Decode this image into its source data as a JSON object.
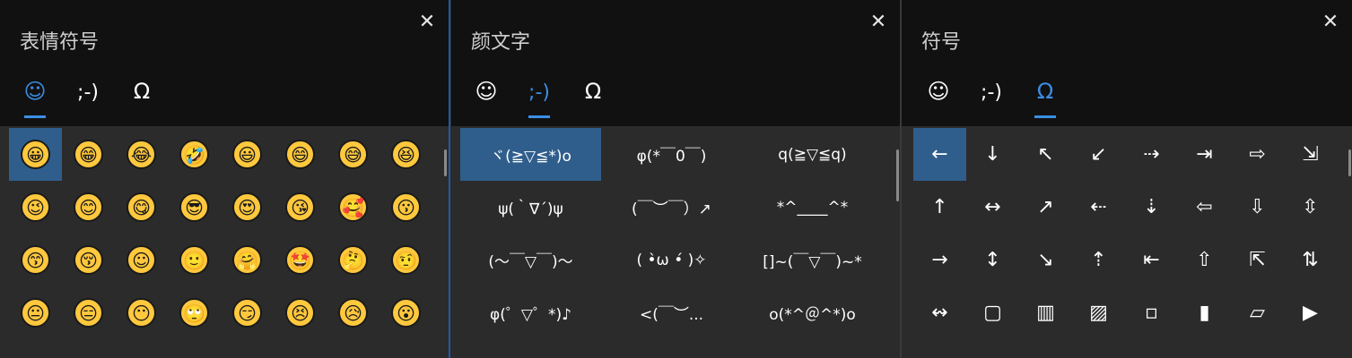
{
  "emoji_panel": {
    "title": "表情符号",
    "close": "✕",
    "tabs": [
      "☺",
      ";-)",
      "Ω"
    ],
    "items": [
      [
        "😀",
        "😁",
        "😂",
        "🤣",
        "😃",
        "😄",
        "😅",
        "😆"
      ],
      [
        "😉",
        "😊",
        "😋",
        "😎",
        "😍",
        "😘",
        "🥰",
        "😗"
      ],
      [
        "😙",
        "😚",
        "☺",
        "🙂",
        "🤗",
        "🤩",
        "🤔",
        "🤨"
      ],
      [
        "😐",
        "😑",
        "😶",
        "🙄",
        "😏",
        "😣",
        "😥",
        "😮"
      ]
    ]
  },
  "kaomoji_panel": {
    "title": "颜文字",
    "close": "✕",
    "tabs": [
      "☺",
      ";-)",
      "Ω"
    ],
    "items": [
      [
        "ヾ(≧▽≦*)o",
        "φ(*￣0￣)",
        "q(≧▽≦q)"
      ],
      [
        "ψ(｀∇´)ψ",
        "(￣︶￣）↗",
        "*^____^*"
      ],
      [
        "(～￣▽￣)～",
        "( •̀ω •́ )✧",
        "[]~(￣▽￣)~*"
      ],
      [
        "φ(゜▽゜*)♪",
        "<(￣︶...",
        "o(*^＠^*)o"
      ]
    ]
  },
  "symbol_panel": {
    "title": "符号",
    "close": "✕",
    "tabs": [
      "☺",
      ";-)",
      "Ω"
    ],
    "items": [
      [
        "←",
        "↓",
        "↖",
        "↙",
        "⇢",
        "⇥",
        "⇨",
        "⇲"
      ],
      [
        "↑",
        "↔",
        "↗",
        "⇠",
        "⇣",
        "⇦",
        "⇩",
        "⇳"
      ],
      [
        "→",
        "↕",
        "↘",
        "⇡",
        "⇤",
        "⇧",
        "⇱",
        "⇅"
      ],
      [
        "↭",
        "▢",
        "▥",
        "▨",
        "▫",
        "▮",
        "▱",
        "▶"
      ]
    ]
  },
  "colors": {
    "accent": "#3b8fe5",
    "selected": "#2f5e8c",
    "header_bg": "#111111",
    "body_bg": "#2b2b2b"
  }
}
